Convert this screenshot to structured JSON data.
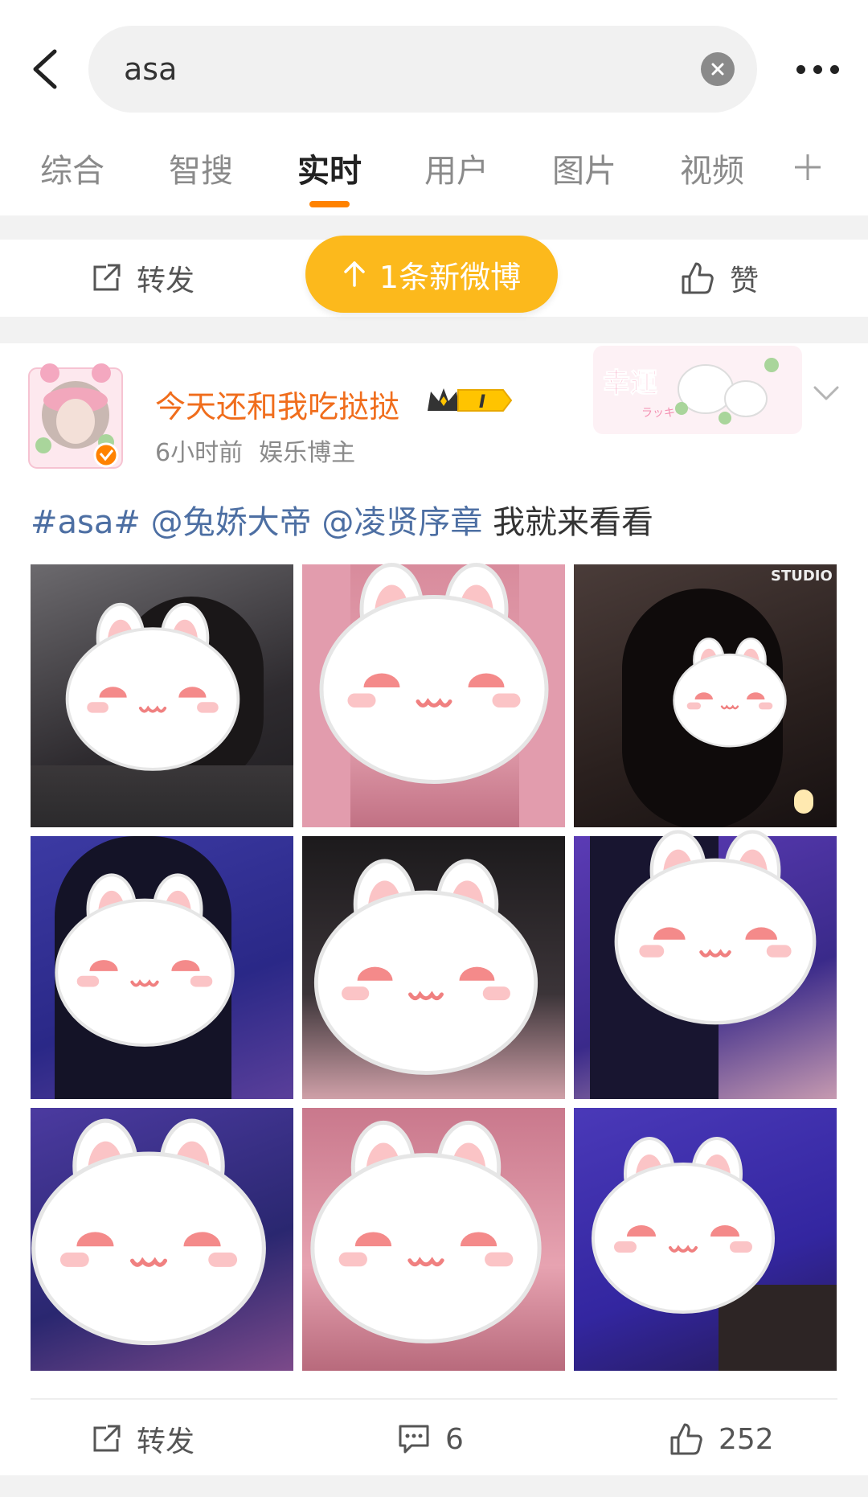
{
  "search": {
    "query": "asa"
  },
  "tabs": [
    "综合",
    "智搜",
    "实时",
    "用户",
    "图片",
    "视频"
  ],
  "active_tab": "实时",
  "top_actions": {
    "repost": "转发",
    "like": "赞"
  },
  "new_post_pill": "1条新微博",
  "post": {
    "username": "今天还和我吃挞挞",
    "vip_level": "I",
    "time": "6小时前",
    "tag": "娱乐博主",
    "hashtag": "#asa#",
    "mention1": "@兔娇大帝",
    "mention2": "@凌贤序章",
    "text": "我就来看看",
    "sticker_text": "幸運",
    "sticker_sub": "ラッキー",
    "watermark": "STUDIO"
  },
  "bottom_actions": {
    "repost": "转发",
    "comments": "6",
    "likes": "252"
  }
}
